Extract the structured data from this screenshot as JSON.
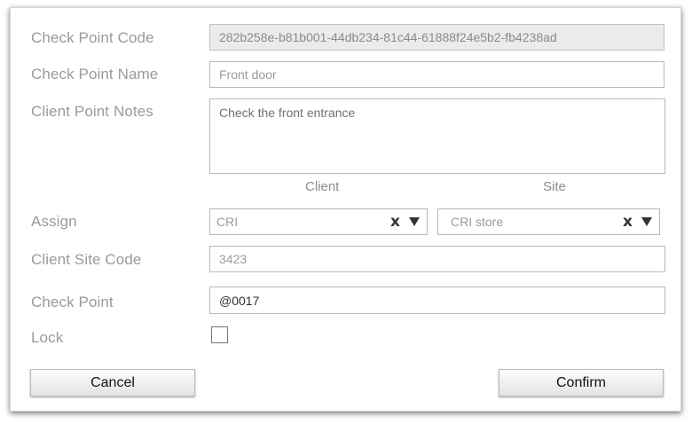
{
  "form": {
    "check_point_code": {
      "label": "Check Point Code",
      "value": "282b258e-b81b001-44db234-81c44-61888f24e5b2-fb4238ad"
    },
    "check_point_name": {
      "label": "Check Point Name",
      "value": "Front door"
    },
    "client_point_notes": {
      "label": "Client Point Notes",
      "value": "Check the front entrance"
    },
    "assign": {
      "label": "Assign",
      "client_header": "Client",
      "site_header": "Site",
      "client_value": "CRI",
      "site_value": "CRI store",
      "clear_glyph": "x"
    },
    "client_site_code": {
      "label": "Client Site Code",
      "value": "3423"
    },
    "check_point": {
      "label": "Check Point",
      "value": "@0017"
    },
    "lock": {
      "label": "Lock",
      "checked": false
    }
  },
  "buttons": {
    "cancel": "Cancel",
    "confirm": "Confirm"
  },
  "colors": {
    "label": "#9a9a9a",
    "readonly_bg": "#ebebeb",
    "border": "#b8b8b8"
  }
}
